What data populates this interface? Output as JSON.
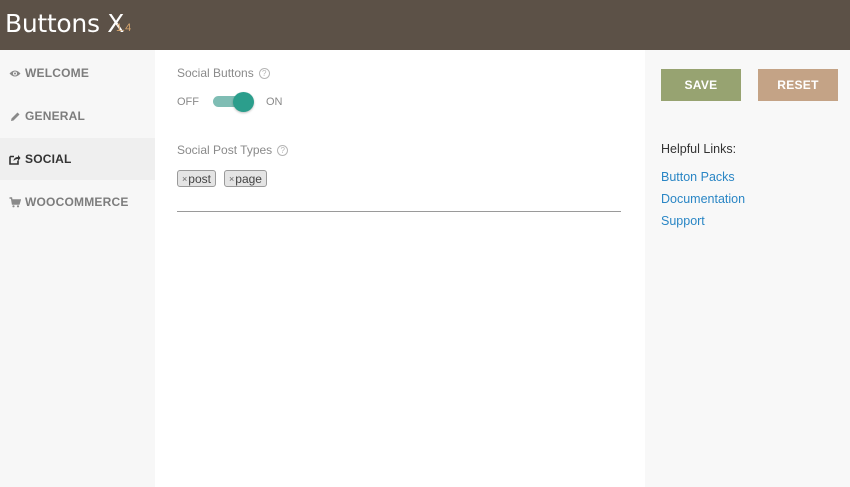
{
  "header": {
    "title": "Buttons X",
    "version": "1.4"
  },
  "sidebar": {
    "items": [
      {
        "label": "WELCOME",
        "icon": "eye-icon"
      },
      {
        "label": "GENERAL",
        "icon": "pencil-icon"
      },
      {
        "label": "SOCIAL",
        "icon": "share-icon",
        "active": true
      },
      {
        "label": "WOOCOMMERCE",
        "icon": "cart-icon"
      }
    ]
  },
  "main": {
    "social_buttons": {
      "label": "Social Buttons",
      "help": "?",
      "off_label": "OFF",
      "on_label": "ON",
      "state": "on"
    },
    "post_types": {
      "label": "Social Post Types",
      "help": "?",
      "remove_glyph": "×",
      "tags": [
        "post",
        "page"
      ]
    }
  },
  "actions": {
    "save_label": "SAVE",
    "reset_label": "RESET"
  },
  "helpful_links": {
    "title": "Helpful Links:",
    "links": [
      "Button Packs",
      "Documentation",
      "Support"
    ]
  },
  "colors": {
    "header_bg": "#5c5147",
    "version": "#d6a56e",
    "toggle": "#2b9e8c",
    "save": "#97a371",
    "reset": "#c4a386",
    "link": "#2a86c5"
  }
}
